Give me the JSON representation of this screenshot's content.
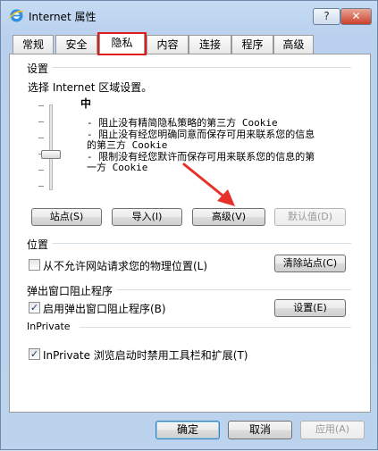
{
  "window": {
    "title": "Internet 属性",
    "help_label": "?",
    "close_label": "✕"
  },
  "tabs": [
    {
      "label": "常规",
      "active": false
    },
    {
      "label": "安全",
      "active": false
    },
    {
      "label": "隐私",
      "active": true
    },
    {
      "label": "内容",
      "active": false
    },
    {
      "label": "连接",
      "active": false
    },
    {
      "label": "程序",
      "active": false
    },
    {
      "label": "高级",
      "active": false
    }
  ],
  "settings": {
    "group_label": "设置",
    "instruction": "选择 Internet 区域设置。",
    "level": "中",
    "descriptions": [
      "- 阻止没有精简隐私策略的第三方 Cookie",
      "- 阻止没有经您明确同意而保存可用来联系您的信息",
      "的第三方 Cookie",
      "- 限制没有经您默许而保存可用来联系您的信息的第",
      "一方 Cookie"
    ],
    "buttons": {
      "sites": "站点(S)",
      "import": "导入(I)",
      "advanced": "高级(V)",
      "default": "默认值(D)"
    }
  },
  "location": {
    "group_label": "位置",
    "checkbox_label": "从不允许网站请求您的物理位置(L)",
    "checked": false,
    "clear_button": "清除站点(C)"
  },
  "popup": {
    "group_label": "弹出窗口阻止程序",
    "checkbox_label": "启用弹出窗口阻止程序(B)",
    "checked": true,
    "settings_button": "设置(E)"
  },
  "inprivate": {
    "group_label": "InPrivate",
    "checkbox_label": "InPrivate 浏览启动时禁用工具栏和扩展(T)",
    "checked": true
  },
  "footer": {
    "ok": "确定",
    "cancel": "取消",
    "apply": "应用(A)"
  },
  "colors": {
    "highlight": "#e01b1b",
    "arrow": "#e8302a"
  }
}
